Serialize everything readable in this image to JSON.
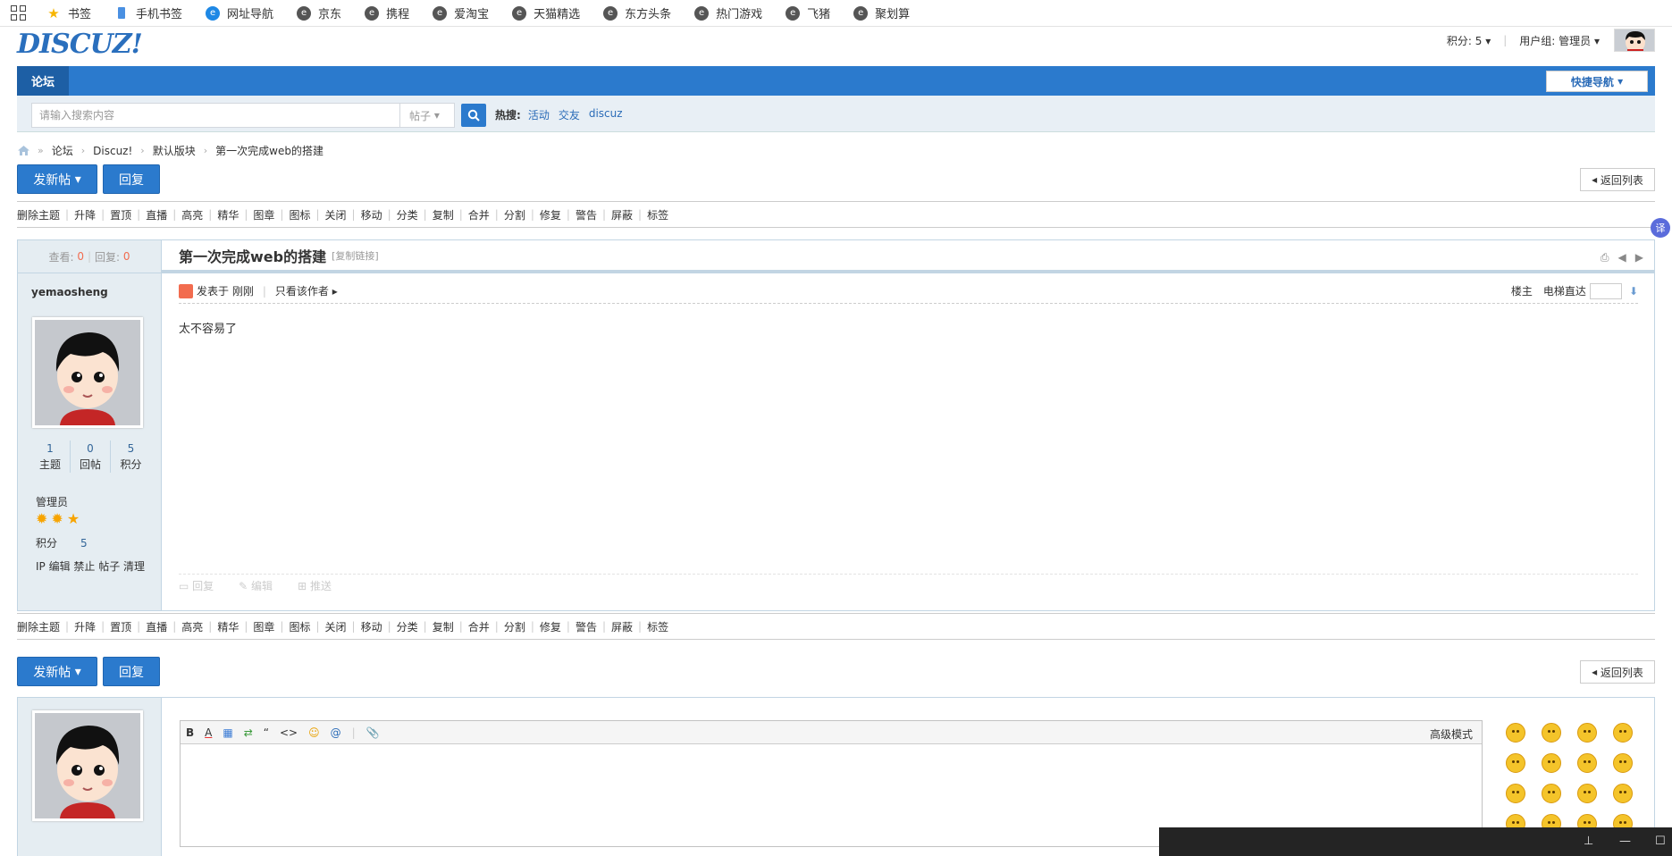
{
  "bookmarks": [
    {
      "label": "书签",
      "icon": "star-icon"
    },
    {
      "label": "手机书签",
      "icon": "phone-bookmark-icon"
    },
    {
      "label": "网址导航",
      "icon": "browser-e-icon"
    },
    {
      "label": "京东",
      "icon": "site-icon"
    },
    {
      "label": "携程",
      "icon": "site-icon"
    },
    {
      "label": "爱淘宝",
      "icon": "site-icon"
    },
    {
      "label": "天猫精选",
      "icon": "site-icon"
    },
    {
      "label": "东方头条",
      "icon": "site-icon"
    },
    {
      "label": "热门游戏",
      "icon": "site-icon"
    },
    {
      "label": "飞猪",
      "icon": "site-icon"
    },
    {
      "label": "聚划算",
      "icon": "site-icon"
    }
  ],
  "header": {
    "logo": "DISCUZ!",
    "points": "积分: 5",
    "usergroup": "用户组: 管理员"
  },
  "nav": {
    "current": "论坛",
    "quick_nav": "快捷导航"
  },
  "search": {
    "placeholder": "请输入搜索内容",
    "type": "帖子",
    "hot_label": "热搜:",
    "hot": [
      "活动",
      "交友",
      "discuz"
    ]
  },
  "breadcrumb": [
    "论坛",
    "Discuz!",
    "默认版块",
    "第一次完成web的搭建"
  ],
  "buttons": {
    "new_thread": "发新帖",
    "reply": "回复",
    "back_list": "返回列表"
  },
  "mod_actions": [
    "删除主题",
    "升降",
    "置顶",
    "直播",
    "高亮",
    "精华",
    "图章",
    "图标",
    "关闭",
    "移动",
    "分类",
    "复制",
    "合并",
    "分割",
    "修复",
    "警告",
    "屏蔽",
    "标签"
  ],
  "thread": {
    "views_label": "查看:",
    "views": "0",
    "replies_label": "回复:",
    "replies": "0",
    "title": "第一次完成web的搭建",
    "copy_link": "[复制链接]",
    "posted_at": "发表于 刚刚",
    "only_author": "只看该作者",
    "floor": "楼主",
    "elevator": "电梯直达",
    "content": "太不容易了",
    "foot_actions": [
      "回复",
      "编辑",
      "推送"
    ]
  },
  "author": {
    "name": "yemaosheng",
    "stats": [
      {
        "value": "1",
        "label": "主题"
      },
      {
        "value": "0",
        "label": "回帖"
      },
      {
        "value": "5",
        "label": "积分"
      }
    ],
    "group": "管理员",
    "points_label": "积分",
    "points": "5",
    "admin_links": "IP 编辑 禁止 帖子 清理"
  },
  "editor": {
    "toolbar": [
      "B",
      "A",
      "▦",
      "⇄",
      "“",
      "<>",
      "☺",
      "@",
      "📎"
    ],
    "advanced": "高级模式"
  },
  "translate": "译"
}
